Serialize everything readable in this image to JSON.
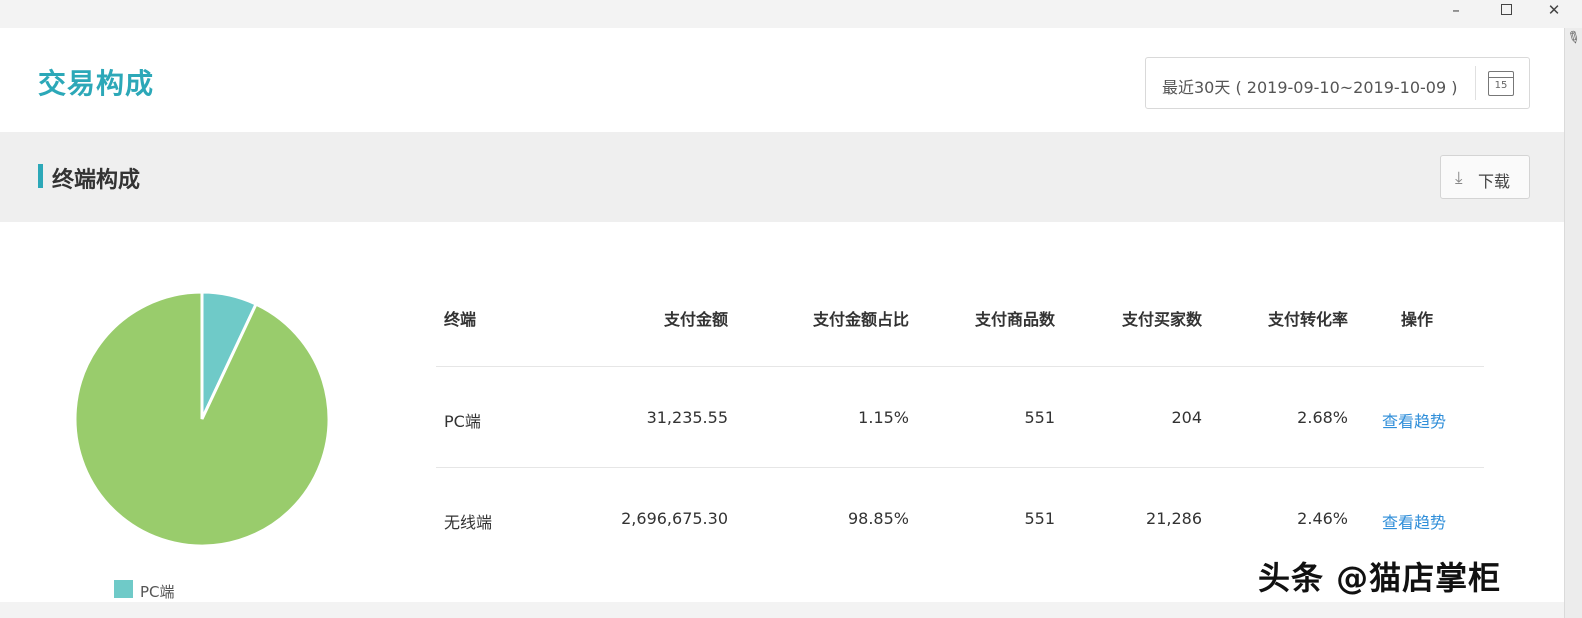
{
  "window": {
    "minimize_glyph": "–",
    "close_glyph": "✕"
  },
  "page": {
    "title": "交易构成"
  },
  "date_range": {
    "text": "最近30天 ( 2019-09-10~2019-10-09 )",
    "calendar_icon": "calendar-icon",
    "calendar_day": "15"
  },
  "section": {
    "title": "终端构成",
    "download_label": "下载",
    "download_icon": "download-icon"
  },
  "chart_data": {
    "type": "pie",
    "categories": [
      "PC端",
      "无线端"
    ],
    "values": [
      1.15,
      98.85
    ],
    "colors": [
      "#6fcac8",
      "#99cc6c"
    ],
    "legend_visible": [
      "PC端"
    ],
    "legend_position": "bottom"
  },
  "table": {
    "headers": [
      "终端",
      "支付金额",
      "支付金额占比",
      "支付商品数",
      "支付买家数",
      "支付转化率",
      "操作"
    ],
    "rows": [
      [
        "PC端",
        "31,235.55",
        "1.15%",
        "551",
        "204",
        "2.68%",
        "查看趋势"
      ],
      [
        "无线端",
        "2,696,675.30",
        "98.85%",
        "551",
        "21,286",
        "2.46%",
        "查看趋势"
      ]
    ]
  },
  "watermark": {
    "text": "头条 @猫店掌柜"
  },
  "colors": {
    "accent": "#2ca8b8",
    "link": "#2f8ed9"
  }
}
